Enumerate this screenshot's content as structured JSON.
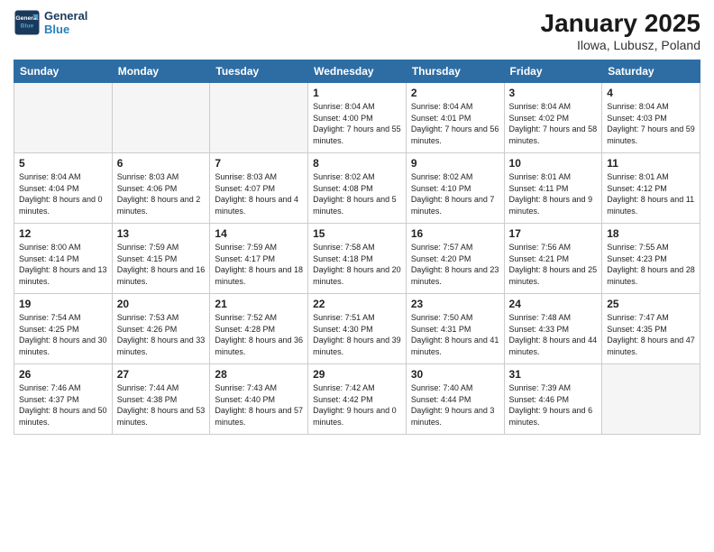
{
  "logo": {
    "line1": "General",
    "line2": "Blue"
  },
  "title": "January 2025",
  "location": "Ilowa, Lubusz, Poland",
  "weekdays": [
    "Sunday",
    "Monday",
    "Tuesday",
    "Wednesday",
    "Thursday",
    "Friday",
    "Saturday"
  ],
  "weeks": [
    [
      {
        "day": "",
        "empty": true
      },
      {
        "day": "",
        "empty": true
      },
      {
        "day": "",
        "empty": true
      },
      {
        "day": "1",
        "sunrise": "8:04 AM",
        "sunset": "4:00 PM",
        "daylight": "7 hours and 55 minutes."
      },
      {
        "day": "2",
        "sunrise": "8:04 AM",
        "sunset": "4:01 PM",
        "daylight": "7 hours and 56 minutes."
      },
      {
        "day": "3",
        "sunrise": "8:04 AM",
        "sunset": "4:02 PM",
        "daylight": "7 hours and 58 minutes."
      },
      {
        "day": "4",
        "sunrise": "8:04 AM",
        "sunset": "4:03 PM",
        "daylight": "7 hours and 59 minutes."
      }
    ],
    [
      {
        "day": "5",
        "sunrise": "8:04 AM",
        "sunset": "4:04 PM",
        "daylight": "8 hours and 0 minutes."
      },
      {
        "day": "6",
        "sunrise": "8:03 AM",
        "sunset": "4:06 PM",
        "daylight": "8 hours and 2 minutes."
      },
      {
        "day": "7",
        "sunrise": "8:03 AM",
        "sunset": "4:07 PM",
        "daylight": "8 hours and 4 minutes."
      },
      {
        "day": "8",
        "sunrise": "8:02 AM",
        "sunset": "4:08 PM",
        "daylight": "8 hours and 5 minutes."
      },
      {
        "day": "9",
        "sunrise": "8:02 AM",
        "sunset": "4:10 PM",
        "daylight": "8 hours and 7 minutes."
      },
      {
        "day": "10",
        "sunrise": "8:01 AM",
        "sunset": "4:11 PM",
        "daylight": "8 hours and 9 minutes."
      },
      {
        "day": "11",
        "sunrise": "8:01 AM",
        "sunset": "4:12 PM",
        "daylight": "8 hours and 11 minutes."
      }
    ],
    [
      {
        "day": "12",
        "sunrise": "8:00 AM",
        "sunset": "4:14 PM",
        "daylight": "8 hours and 13 minutes."
      },
      {
        "day": "13",
        "sunrise": "7:59 AM",
        "sunset": "4:15 PM",
        "daylight": "8 hours and 16 minutes."
      },
      {
        "day": "14",
        "sunrise": "7:59 AM",
        "sunset": "4:17 PM",
        "daylight": "8 hours and 18 minutes."
      },
      {
        "day": "15",
        "sunrise": "7:58 AM",
        "sunset": "4:18 PM",
        "daylight": "8 hours and 20 minutes."
      },
      {
        "day": "16",
        "sunrise": "7:57 AM",
        "sunset": "4:20 PM",
        "daylight": "8 hours and 23 minutes."
      },
      {
        "day": "17",
        "sunrise": "7:56 AM",
        "sunset": "4:21 PM",
        "daylight": "8 hours and 25 minutes."
      },
      {
        "day": "18",
        "sunrise": "7:55 AM",
        "sunset": "4:23 PM",
        "daylight": "8 hours and 28 minutes."
      }
    ],
    [
      {
        "day": "19",
        "sunrise": "7:54 AM",
        "sunset": "4:25 PM",
        "daylight": "8 hours and 30 minutes."
      },
      {
        "day": "20",
        "sunrise": "7:53 AM",
        "sunset": "4:26 PM",
        "daylight": "8 hours and 33 minutes."
      },
      {
        "day": "21",
        "sunrise": "7:52 AM",
        "sunset": "4:28 PM",
        "daylight": "8 hours and 36 minutes."
      },
      {
        "day": "22",
        "sunrise": "7:51 AM",
        "sunset": "4:30 PM",
        "daylight": "8 hours and 39 minutes."
      },
      {
        "day": "23",
        "sunrise": "7:50 AM",
        "sunset": "4:31 PM",
        "daylight": "8 hours and 41 minutes."
      },
      {
        "day": "24",
        "sunrise": "7:48 AM",
        "sunset": "4:33 PM",
        "daylight": "8 hours and 44 minutes."
      },
      {
        "day": "25",
        "sunrise": "7:47 AM",
        "sunset": "4:35 PM",
        "daylight": "8 hours and 47 minutes."
      }
    ],
    [
      {
        "day": "26",
        "sunrise": "7:46 AM",
        "sunset": "4:37 PM",
        "daylight": "8 hours and 50 minutes."
      },
      {
        "day": "27",
        "sunrise": "7:44 AM",
        "sunset": "4:38 PM",
        "daylight": "8 hours and 53 minutes."
      },
      {
        "day": "28",
        "sunrise": "7:43 AM",
        "sunset": "4:40 PM",
        "daylight": "8 hours and 57 minutes."
      },
      {
        "day": "29",
        "sunrise": "7:42 AM",
        "sunset": "4:42 PM",
        "daylight": "9 hours and 0 minutes."
      },
      {
        "day": "30",
        "sunrise": "7:40 AM",
        "sunset": "4:44 PM",
        "daylight": "9 hours and 3 minutes."
      },
      {
        "day": "31",
        "sunrise": "7:39 AM",
        "sunset": "4:46 PM",
        "daylight": "9 hours and 6 minutes."
      },
      {
        "day": "",
        "empty": true
      }
    ]
  ]
}
